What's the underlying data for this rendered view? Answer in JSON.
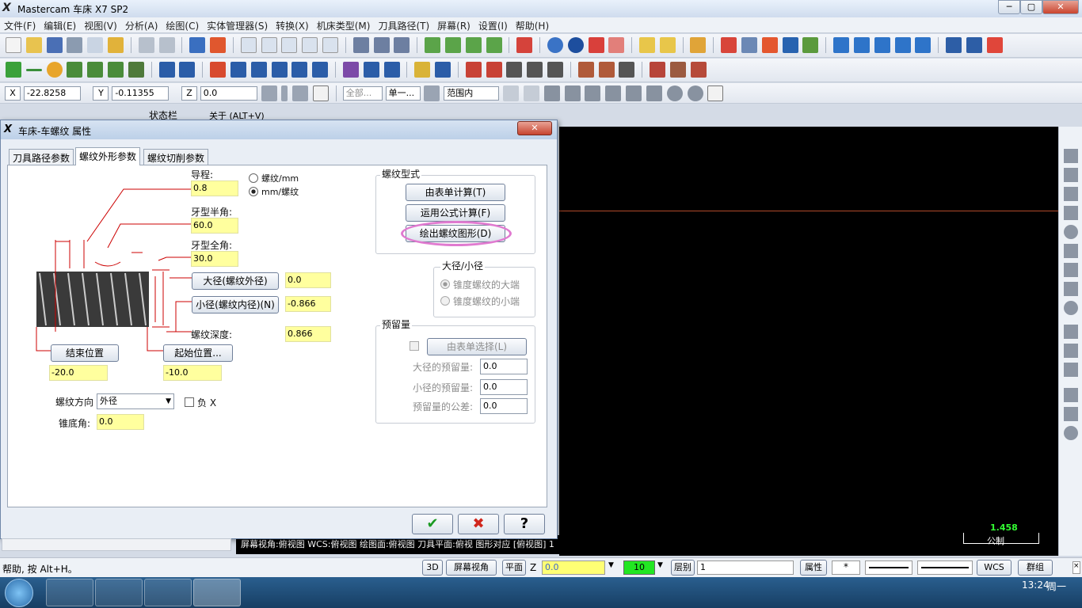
{
  "window": {
    "title": "Mastercam 车床 X7 SP2",
    "min": "─",
    "max": "▢",
    "close": "✕"
  },
  "menu": [
    "文件(F)",
    "编辑(E)",
    "视图(V)",
    "分析(A)",
    "绘图(C)",
    "实体管理器(S)",
    "转换(X)",
    "机床类型(M)",
    "刀具路径(T)",
    "屏幕(R)",
    "设置(I)",
    "帮助(H)"
  ],
  "coords": {
    "x_label": "X",
    "x_value": "-22.8258",
    "y_label": "Y",
    "y_value": "-0.11355",
    "z_label": "Z",
    "z_value": "0.0",
    "all": "全部...",
    "single": "单一...",
    "range": "范围内"
  },
  "sub_labels": {
    "status": "状态栏",
    "about": "关于 (ALT+V)"
  },
  "dialog": {
    "title": "车床-车螺纹 属性",
    "tabs": [
      "刀具路径参数",
      "螺纹外形参数",
      "螺纹切削参数"
    ],
    "lead_label": "导程:",
    "lead_value": "0.8",
    "unit_opt1": "螺纹/mm",
    "unit_opt2": "mm/螺纹",
    "half_angle_label": "牙型半角:",
    "half_angle_value": "60.0",
    "full_angle_label": "牙型全角:",
    "full_angle_value": "30.0",
    "major_btn": "大径(螺纹外径)",
    "major_value": "0.0",
    "minor_btn": "小径(螺纹内径)(N)",
    "minor_value": "-0.866",
    "depth_label": "螺纹深度:",
    "depth_value": "0.866",
    "end_btn": "结束位置",
    "end_value": "-20.0",
    "start_btn": "起始位置...",
    "start_value": "-10.0",
    "dir_label": "螺纹方向",
    "dir_value": "外径",
    "neg_x": "负 X",
    "taper_label": "锥底角:",
    "taper_value": "0.0",
    "form_group": "螺纹型式",
    "from_table": "由表单计算(T)",
    "formula": "运用公式计算(F)",
    "draw": "绘出螺纹图形(D)",
    "diam_group": "大径/小径",
    "diam_opt1": "锥度螺纹的大端",
    "diam_opt2": "锥度螺纹的小端",
    "allow_group": "预留量",
    "allow_btn": "由表单选择(L)",
    "allow_major_label": "大径的预留量:",
    "allow_major": "0.0",
    "allow_minor_label": "小径的预留量:",
    "allow_minor": "0.0",
    "allow_tol_label": "预留量的公差:",
    "allow_tol": "0.0",
    "ok": "✔",
    "cancel": "✖",
    "help": "?"
  },
  "viewport": {
    "scale": "1.458",
    "unit": "公制",
    "info": "屏幕视角:俯视图  WCS:俯视图  绘图面:俯视图  刀具平面:俯视 图形对应 [俯视图] 1"
  },
  "status": {
    "help": "帮助, 按 Alt+H。",
    "3d": "3D",
    "screen_view": "屏幕视角",
    "plane": "平面",
    "z": "Z",
    "z_value": "0.0",
    "color": "10",
    "level_label": "层别",
    "level": "1",
    "attr": "属性",
    "wcs": "WCS",
    "group": "群组"
  },
  "clock": {
    "time": "13:24",
    "day": "周一"
  }
}
